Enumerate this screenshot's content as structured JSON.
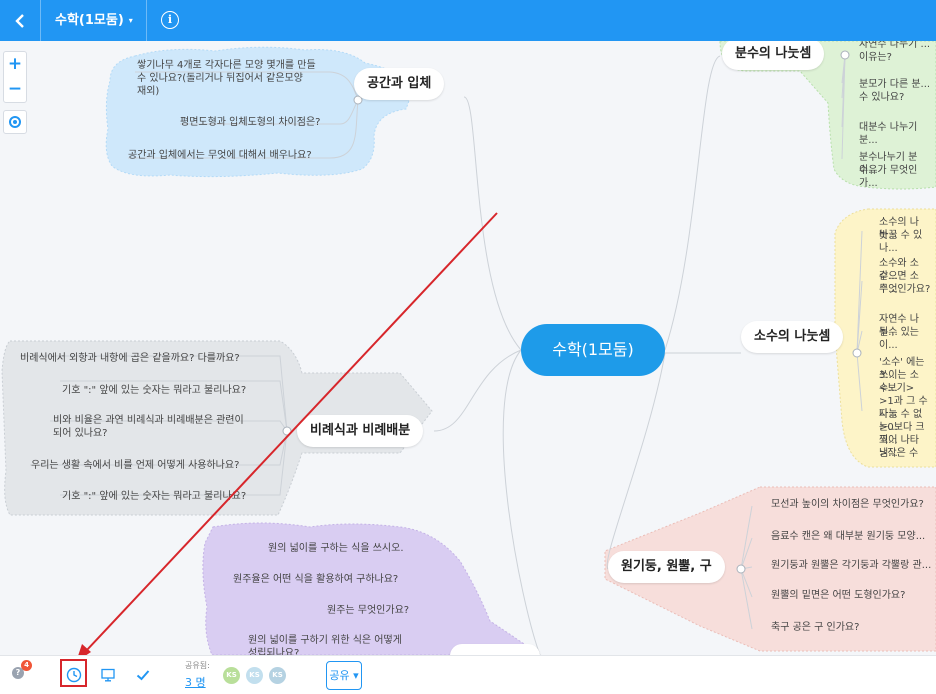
{
  "topbar": {
    "back_icon": "chevron-left-icon",
    "title": "수학(1모둠)",
    "caret": "▾",
    "info_icon": "i"
  },
  "zoom": {
    "plus": "+",
    "minus": "−"
  },
  "map": {
    "central": "수학(1모둠)",
    "branches": {
      "solid": {
        "label": "공간과 입체",
        "leaves": [
          "쌓기나무 4개로 각자다른 모양 몇개를 만들",
          "수 있나요?(돌리거나 뒤집어서 같은모양",
          "재외)",
          "평면도형과 입체도형의 차이점은?",
          "공간과 입체에서는 무엇에 대해서 배우나요?"
        ]
      },
      "ratio": {
        "label": "비례식과 비례배분",
        "leaves": [
          "비례식에서 외항과 내항에 곱은 같을까요? 다를까요?",
          "기호 \":\" 앞에 있는 숫자는 뭐라고 불리나요?",
          "비와 비율은 과연 비례식과 비례배분은 관련이",
          "되어 있나요?",
          "우리는 생활 속에서 비를 언제 어떻게 사용하나요?",
          "기호 \":\" 앞에 있는 숫자는 뭐라고 불리나요?"
        ]
      },
      "circle": {
        "leaves": [
          "원의 넓이를 구하는 식을 쓰시오.",
          "원주율은 어떤 식을 활용하여 구하나요?",
          "원주는 무엇인가요?",
          "원의 넓이를 구하기 위한 식은 어떻게",
          "성립되나요?"
        ]
      },
      "fraction": {
        "label": "분수의 나눗셈",
        "leaves": [
          "자연수 나누기 ...",
          "이유는?",
          "분모가 다른 분...",
          "수 있나요?",
          "대분수 나누기 분...",
          "분수나누기 분수...",
          "이유가 무엇인가..."
        ]
      },
      "decimal": {
        "label": "소수의 나눗셈",
        "leaves": [
          "소수의 나눗...",
          "바꿀 수 있나...",
          "소수와 소수...",
          "같으면 소수...",
          "무엇인가요?",
          "자연수 나누...",
          "될수 있는 이...",
          "'소수' 에는 3...",
          "쓰이는 소수...",
          "<보기>",
          ">1과 그 수 자...",
          "나눌 수 없는...",
          ">0보다 크고...",
          "찍어 나타냄...",
          ">작은 수"
        ]
      },
      "cylinder": {
        "label": "원기둥, 원뿔, 구",
        "leaves": [
          "모선과 높이의 차이점은 무엇인가요?",
          "음료수 캔은 왜 대부분 원기둥 모양...",
          "원기둥과 원뿔은 각기둥과 각뿔랑 관...",
          "원뿔의 밑면은 어떤 도형인가요?",
          "축구 공은 구 인가요?"
        ]
      }
    },
    "colors": {
      "solid": "#cfe8fb",
      "ratio": "#e3e6e9",
      "circle": "#d9cdf2",
      "fraction": "#def2d6",
      "decimal": "#fdf4c8",
      "cylinder": "#f7dedb",
      "central": "#1e9be9",
      "accent": "#2196f3",
      "annotation": "#d7262b"
    }
  },
  "bottombar": {
    "help": "?",
    "badge": "4",
    "history_icon": "clock-icon",
    "present_icon": "monitor-icon",
    "check_icon": "check-icon",
    "share_meta": "공유됨:",
    "share_count": "3 명",
    "avatars": [
      "KS",
      "KS",
      "KS"
    ],
    "share_button": "공유 ▾"
  }
}
